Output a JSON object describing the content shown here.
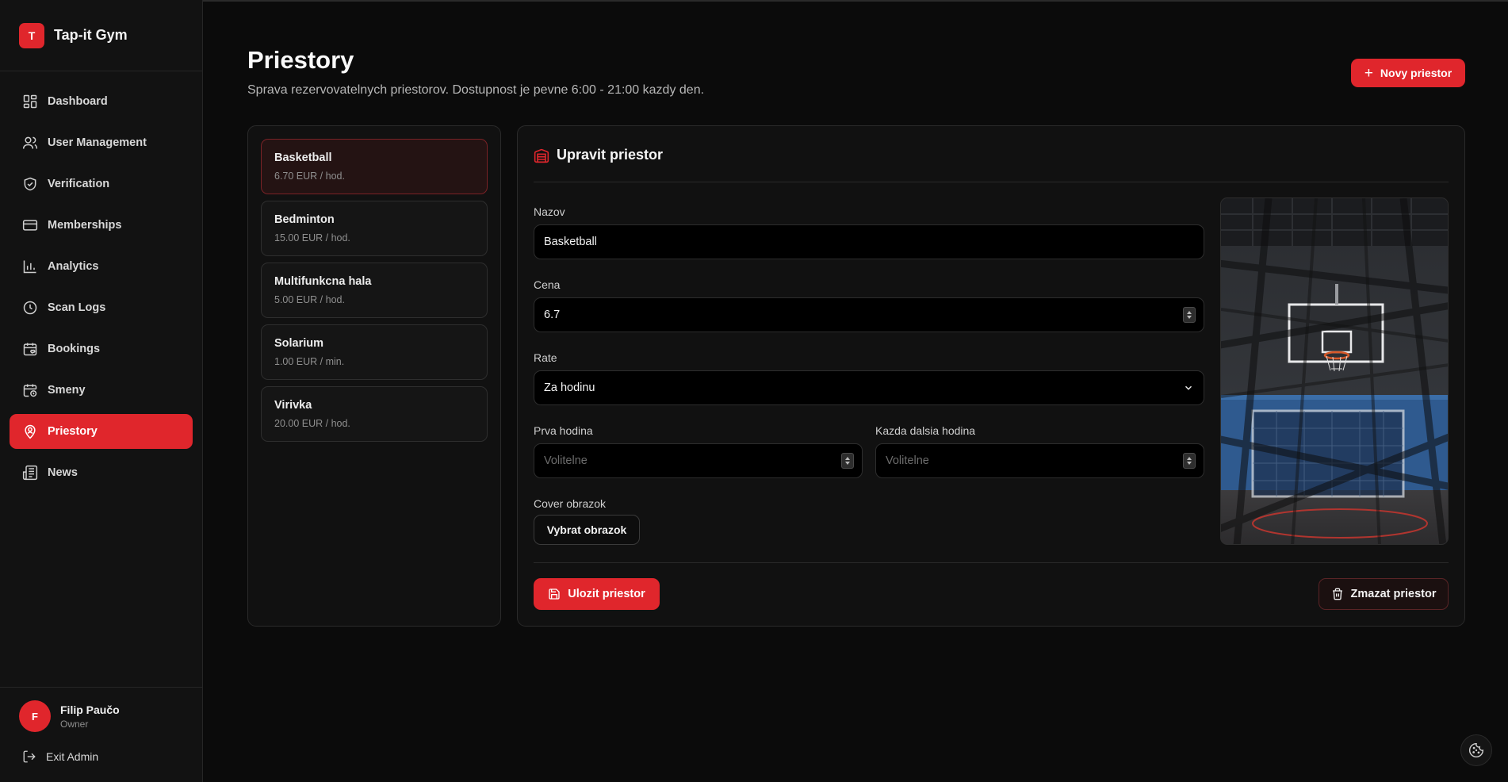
{
  "brand": {
    "logo_letter": "T",
    "name": "Tap-it Gym"
  },
  "sidebar": {
    "items": [
      {
        "label": "Dashboard",
        "icon": "dashboard-icon"
      },
      {
        "label": "User Management",
        "icon": "users-icon"
      },
      {
        "label": "Verification",
        "icon": "shield-check-icon"
      },
      {
        "label": "Memberships",
        "icon": "credit-card-icon"
      },
      {
        "label": "Analytics",
        "icon": "bar-chart-icon"
      },
      {
        "label": "Scan Logs",
        "icon": "clock-icon"
      },
      {
        "label": "Bookings",
        "icon": "calendar-heart-icon"
      },
      {
        "label": "Smeny",
        "icon": "calendar-clock-icon"
      },
      {
        "label": "Priestory",
        "icon": "map-pin-user-icon",
        "active": true
      },
      {
        "label": "News",
        "icon": "newspaper-icon"
      }
    ],
    "user": {
      "avatar_letter": "F",
      "name": "Filip Paučo",
      "role": "Owner"
    },
    "exit_label": "Exit Admin"
  },
  "header": {
    "title": "Priestory",
    "subtitle": "Sprava rezervovatelnych priestorov. Dostupnost je pevne 6:00 - 21:00 kazdy den.",
    "new_button": "Novy priestor"
  },
  "spaces": [
    {
      "name": "Basketball",
      "price": "6.70 EUR / hod.",
      "selected": true
    },
    {
      "name": "Bedminton",
      "price": "15.00 EUR / hod."
    },
    {
      "name": "Multifunkcna hala",
      "price": "5.00 EUR / hod."
    },
    {
      "name": "Solarium",
      "price": "1.00 EUR / min."
    },
    {
      "name": "Virivka",
      "price": "20.00 EUR / hod."
    }
  ],
  "editor": {
    "title": "Upravit priestor",
    "name_label": "Nazov",
    "name_value": "Basketball",
    "price_label": "Cena",
    "price_value": "6.7",
    "rate_label": "Rate",
    "rate_value": "Za hodinu",
    "first_hour_label": "Prva hodina",
    "first_hour_placeholder": "Volitelne",
    "next_hour_label": "Kazda dalsia hodina",
    "next_hour_placeholder": "Volitelne",
    "cover_label": "Cover obrazok",
    "pick_button": "Vybrat obrazok",
    "save_button": "Ulozit priestor",
    "delete_button": "Zmazat priestor"
  },
  "colors": {
    "accent": "#e0262c",
    "background": "#0b0b0b",
    "panel": "#111111"
  }
}
